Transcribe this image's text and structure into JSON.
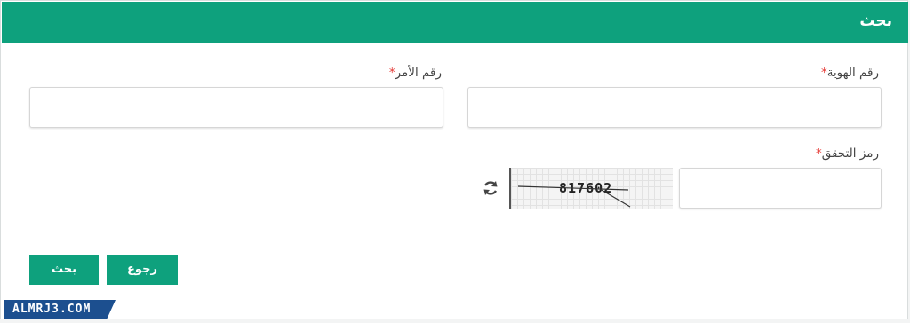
{
  "header": {
    "title": "بحث"
  },
  "form": {
    "id_number": {
      "label": "رقم الهوية",
      "required_mark": "*",
      "value": ""
    },
    "order_number": {
      "label": "رقم الأمر",
      "required_mark": "*",
      "value": ""
    },
    "captcha": {
      "label": "رمز التحقق",
      "required_mark": "*",
      "image_code": "817602",
      "value": "",
      "refresh_icon": "refresh-icon"
    }
  },
  "buttons": {
    "search_label": "بحث",
    "back_label": "رجوع"
  },
  "watermark": {
    "text": "ALMRJ3.COM"
  },
  "colors": {
    "accent": "#0ea17d",
    "required": "#e53935",
    "watermark": "#1c4f8f"
  }
}
